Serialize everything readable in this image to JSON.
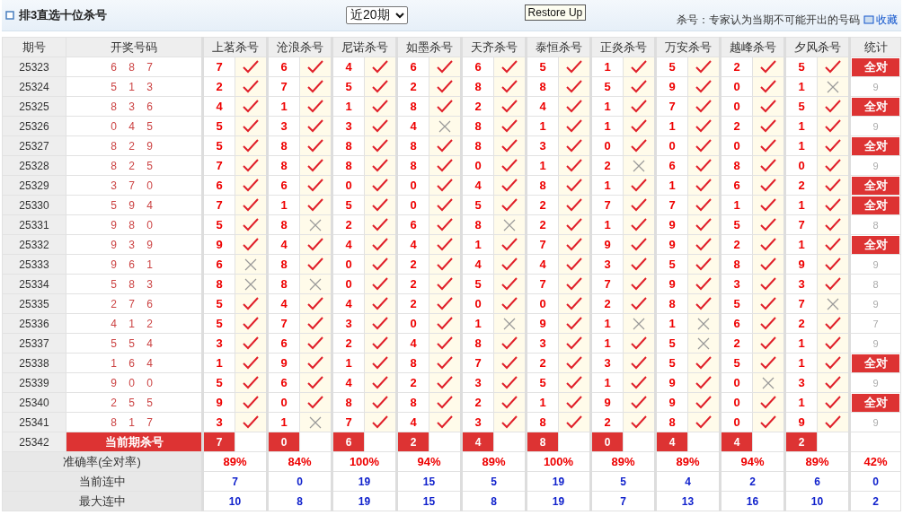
{
  "header": {
    "title": "排3直选十位杀号",
    "period_select": "近20期",
    "tooltip": "Restore Up",
    "note": "杀号：专家认为当期不可能开出的号码",
    "bookmark": "收藏"
  },
  "columns": [
    "期号",
    "开奖号码",
    "上茗杀号",
    "沧浪杀号",
    "尼诺杀号",
    "如墨杀号",
    "天齐杀号",
    "泰恒杀号",
    "正炎杀号",
    "万安杀号",
    "越峰杀号",
    "夕风杀号",
    "统计"
  ],
  "rows": [
    {
      "period": "25323",
      "draw": "6 8 7",
      "picks": [
        {
          "number": "7",
          "hit": true
        },
        {
          "number": "6",
          "hit": true
        },
        {
          "number": "4",
          "hit": true
        },
        {
          "number": "6",
          "hit": true
        },
        {
          "number": "6",
          "hit": true
        },
        {
          "number": "5",
          "hit": true
        },
        {
          "number": "1",
          "hit": true
        },
        {
          "number": "5",
          "hit": true
        },
        {
          "number": "2",
          "hit": true
        },
        {
          "number": "5",
          "hit": true
        }
      ],
      "stat": {
        "text": "全对",
        "all_correct": true
      }
    },
    {
      "period": "25324",
      "draw": "5 1 3",
      "picks": [
        {
          "number": "2",
          "hit": true
        },
        {
          "number": "7",
          "hit": true
        },
        {
          "number": "5",
          "hit": true
        },
        {
          "number": "2",
          "hit": true
        },
        {
          "number": "8",
          "hit": true
        },
        {
          "number": "8",
          "hit": true
        },
        {
          "number": "5",
          "hit": true
        },
        {
          "number": "9",
          "hit": true
        },
        {
          "number": "0",
          "hit": true
        },
        {
          "number": "1",
          "hit": false
        }
      ],
      "stat": {
        "text": "9",
        "all_correct": false
      }
    },
    {
      "period": "25325",
      "draw": "8 3 6",
      "picks": [
        {
          "number": "4",
          "hit": true
        },
        {
          "number": "1",
          "hit": true
        },
        {
          "number": "1",
          "hit": true
        },
        {
          "number": "8",
          "hit": true
        },
        {
          "number": "2",
          "hit": true
        },
        {
          "number": "4",
          "hit": true
        },
        {
          "number": "1",
          "hit": true
        },
        {
          "number": "7",
          "hit": true
        },
        {
          "number": "0",
          "hit": true
        },
        {
          "number": "5",
          "hit": true
        }
      ],
      "stat": {
        "text": "全对",
        "all_correct": true
      }
    },
    {
      "period": "25326",
      "draw": "0 4 5",
      "picks": [
        {
          "number": "5",
          "hit": true
        },
        {
          "number": "3",
          "hit": true
        },
        {
          "number": "3",
          "hit": true
        },
        {
          "number": "4",
          "hit": false
        },
        {
          "number": "8",
          "hit": true
        },
        {
          "number": "1",
          "hit": true
        },
        {
          "number": "1",
          "hit": true
        },
        {
          "number": "1",
          "hit": true
        },
        {
          "number": "2",
          "hit": true
        },
        {
          "number": "1",
          "hit": true
        }
      ],
      "stat": {
        "text": "9",
        "all_correct": false
      }
    },
    {
      "period": "25327",
      "draw": "8 2 9",
      "picks": [
        {
          "number": "5",
          "hit": true
        },
        {
          "number": "8",
          "hit": true
        },
        {
          "number": "8",
          "hit": true
        },
        {
          "number": "8",
          "hit": true
        },
        {
          "number": "8",
          "hit": true
        },
        {
          "number": "3",
          "hit": true
        },
        {
          "number": "0",
          "hit": true
        },
        {
          "number": "0",
          "hit": true
        },
        {
          "number": "0",
          "hit": true
        },
        {
          "number": "1",
          "hit": true
        }
      ],
      "stat": {
        "text": "全对",
        "all_correct": true
      }
    },
    {
      "period": "25328",
      "draw": "8 2 5",
      "picks": [
        {
          "number": "7",
          "hit": true
        },
        {
          "number": "8",
          "hit": true
        },
        {
          "number": "8",
          "hit": true
        },
        {
          "number": "8",
          "hit": true
        },
        {
          "number": "0",
          "hit": true
        },
        {
          "number": "1",
          "hit": true
        },
        {
          "number": "2",
          "hit": false
        },
        {
          "number": "6",
          "hit": true
        },
        {
          "number": "8",
          "hit": true
        },
        {
          "number": "0",
          "hit": true
        }
      ],
      "stat": {
        "text": "9",
        "all_correct": false
      }
    },
    {
      "period": "25329",
      "draw": "3 7 0",
      "picks": [
        {
          "number": "6",
          "hit": true
        },
        {
          "number": "6",
          "hit": true
        },
        {
          "number": "0",
          "hit": true
        },
        {
          "number": "0",
          "hit": true
        },
        {
          "number": "4",
          "hit": true
        },
        {
          "number": "8",
          "hit": true
        },
        {
          "number": "1",
          "hit": true
        },
        {
          "number": "1",
          "hit": true
        },
        {
          "number": "6",
          "hit": true
        },
        {
          "number": "2",
          "hit": true
        }
      ],
      "stat": {
        "text": "全对",
        "all_correct": true
      }
    },
    {
      "period": "25330",
      "draw": "5 9 4",
      "picks": [
        {
          "number": "7",
          "hit": true
        },
        {
          "number": "1",
          "hit": true
        },
        {
          "number": "5",
          "hit": true
        },
        {
          "number": "0",
          "hit": true
        },
        {
          "number": "5",
          "hit": true
        },
        {
          "number": "2",
          "hit": true
        },
        {
          "number": "7",
          "hit": true
        },
        {
          "number": "7",
          "hit": true
        },
        {
          "number": "1",
          "hit": true
        },
        {
          "number": "1",
          "hit": true
        }
      ],
      "stat": {
        "text": "全对",
        "all_correct": true
      }
    },
    {
      "period": "25331",
      "draw": "9 8 0",
      "picks": [
        {
          "number": "5",
          "hit": true
        },
        {
          "number": "8",
          "hit": false
        },
        {
          "number": "2",
          "hit": true
        },
        {
          "number": "6",
          "hit": true
        },
        {
          "number": "8",
          "hit": false
        },
        {
          "number": "2",
          "hit": true
        },
        {
          "number": "1",
          "hit": true
        },
        {
          "number": "9",
          "hit": true
        },
        {
          "number": "5",
          "hit": true
        },
        {
          "number": "7",
          "hit": true
        }
      ],
      "stat": {
        "text": "8",
        "all_correct": false
      }
    },
    {
      "period": "25332",
      "draw": "9 3 9",
      "picks": [
        {
          "number": "9",
          "hit": true
        },
        {
          "number": "4",
          "hit": true
        },
        {
          "number": "4",
          "hit": true
        },
        {
          "number": "4",
          "hit": true
        },
        {
          "number": "1",
          "hit": true
        },
        {
          "number": "7",
          "hit": true
        },
        {
          "number": "9",
          "hit": true
        },
        {
          "number": "9",
          "hit": true
        },
        {
          "number": "2",
          "hit": true
        },
        {
          "number": "1",
          "hit": true
        }
      ],
      "stat": {
        "text": "全对",
        "all_correct": true
      }
    },
    {
      "period": "25333",
      "draw": "9 6 1",
      "picks": [
        {
          "number": "6",
          "hit": false
        },
        {
          "number": "8",
          "hit": true
        },
        {
          "number": "0",
          "hit": true
        },
        {
          "number": "2",
          "hit": true
        },
        {
          "number": "4",
          "hit": true
        },
        {
          "number": "4",
          "hit": true
        },
        {
          "number": "3",
          "hit": true
        },
        {
          "number": "5",
          "hit": true
        },
        {
          "number": "8",
          "hit": true
        },
        {
          "number": "9",
          "hit": true
        }
      ],
      "stat": {
        "text": "9",
        "all_correct": false
      }
    },
    {
      "period": "25334",
      "draw": "5 8 3",
      "picks": [
        {
          "number": "8",
          "hit": false
        },
        {
          "number": "8",
          "hit": false
        },
        {
          "number": "0",
          "hit": true
        },
        {
          "number": "2",
          "hit": true
        },
        {
          "number": "5",
          "hit": true
        },
        {
          "number": "7",
          "hit": true
        },
        {
          "number": "7",
          "hit": true
        },
        {
          "number": "9",
          "hit": true
        },
        {
          "number": "3",
          "hit": true
        },
        {
          "number": "3",
          "hit": true
        }
      ],
      "stat": {
        "text": "8",
        "all_correct": false
      }
    },
    {
      "period": "25335",
      "draw": "2 7 6",
      "picks": [
        {
          "number": "5",
          "hit": true
        },
        {
          "number": "4",
          "hit": true
        },
        {
          "number": "4",
          "hit": true
        },
        {
          "number": "2",
          "hit": true
        },
        {
          "number": "0",
          "hit": true
        },
        {
          "number": "0",
          "hit": true
        },
        {
          "number": "2",
          "hit": true
        },
        {
          "number": "8",
          "hit": true
        },
        {
          "number": "5",
          "hit": true
        },
        {
          "number": "7",
          "hit": false
        }
      ],
      "stat": {
        "text": "9",
        "all_correct": false
      }
    },
    {
      "period": "25336",
      "draw": "4 1 2",
      "picks": [
        {
          "number": "5",
          "hit": true
        },
        {
          "number": "7",
          "hit": true
        },
        {
          "number": "3",
          "hit": true
        },
        {
          "number": "0",
          "hit": true
        },
        {
          "number": "1",
          "hit": false
        },
        {
          "number": "9",
          "hit": true
        },
        {
          "number": "1",
          "hit": false
        },
        {
          "number": "1",
          "hit": false
        },
        {
          "number": "6",
          "hit": true
        },
        {
          "number": "2",
          "hit": true
        }
      ],
      "stat": {
        "text": "7",
        "all_correct": false
      }
    },
    {
      "period": "25337",
      "draw": "5 5 4",
      "picks": [
        {
          "number": "3",
          "hit": true
        },
        {
          "number": "6",
          "hit": true
        },
        {
          "number": "2",
          "hit": true
        },
        {
          "number": "4",
          "hit": true
        },
        {
          "number": "8",
          "hit": true
        },
        {
          "number": "3",
          "hit": true
        },
        {
          "number": "1",
          "hit": true
        },
        {
          "number": "5",
          "hit": false
        },
        {
          "number": "2",
          "hit": true
        },
        {
          "number": "1",
          "hit": true
        }
      ],
      "stat": {
        "text": "9",
        "all_correct": false
      }
    },
    {
      "period": "25338",
      "draw": "1 6 4",
      "picks": [
        {
          "number": "1",
          "hit": true
        },
        {
          "number": "9",
          "hit": true
        },
        {
          "number": "1",
          "hit": true
        },
        {
          "number": "8",
          "hit": true
        },
        {
          "number": "7",
          "hit": true
        },
        {
          "number": "2",
          "hit": true
        },
        {
          "number": "3",
          "hit": true
        },
        {
          "number": "5",
          "hit": true
        },
        {
          "number": "5",
          "hit": true
        },
        {
          "number": "1",
          "hit": true
        }
      ],
      "stat": {
        "text": "全对",
        "all_correct": true
      }
    },
    {
      "period": "25339",
      "draw": "9 0 0",
      "picks": [
        {
          "number": "5",
          "hit": true
        },
        {
          "number": "6",
          "hit": true
        },
        {
          "number": "4",
          "hit": true
        },
        {
          "number": "2",
          "hit": true
        },
        {
          "number": "3",
          "hit": true
        },
        {
          "number": "5",
          "hit": true
        },
        {
          "number": "1",
          "hit": true
        },
        {
          "number": "9",
          "hit": true
        },
        {
          "number": "0",
          "hit": false
        },
        {
          "number": "3",
          "hit": true
        }
      ],
      "stat": {
        "text": "9",
        "all_correct": false
      }
    },
    {
      "period": "25340",
      "draw": "2 5 5",
      "picks": [
        {
          "number": "9",
          "hit": true
        },
        {
          "number": "0",
          "hit": true
        },
        {
          "number": "8",
          "hit": true
        },
        {
          "number": "8",
          "hit": true
        },
        {
          "number": "2",
          "hit": true
        },
        {
          "number": "1",
          "hit": true
        },
        {
          "number": "9",
          "hit": true
        },
        {
          "number": "9",
          "hit": true
        },
        {
          "number": "0",
          "hit": true
        },
        {
          "number": "1",
          "hit": true
        }
      ],
      "stat": {
        "text": "全对",
        "all_correct": true
      }
    },
    {
      "period": "25341",
      "draw": "8 1 7",
      "picks": [
        {
          "number": "3",
          "hit": true
        },
        {
          "number": "1",
          "hit": false
        },
        {
          "number": "7",
          "hit": true
        },
        {
          "number": "4",
          "hit": true
        },
        {
          "number": "3",
          "hit": true
        },
        {
          "number": "8",
          "hit": true
        },
        {
          "number": "2",
          "hit": true
        },
        {
          "number": "8",
          "hit": true
        },
        {
          "number": "0",
          "hit": true
        },
        {
          "number": "9",
          "hit": true
        }
      ],
      "stat": {
        "text": "9",
        "all_correct": false
      }
    }
  ],
  "current": {
    "period": "25342",
    "label": "当前期杀号",
    "picks": [
      "7",
      "0",
      "6",
      "2",
      "4",
      "8",
      "0",
      "4",
      "4",
      "2"
    ]
  },
  "summary": [
    {
      "label": "准确率(全对率)",
      "kind": "rate",
      "values": [
        "89%",
        "84%",
        "100%",
        "94%",
        "89%",
        "100%",
        "89%",
        "89%",
        "94%",
        "89%",
        "42%"
      ]
    },
    {
      "label": "当前连中",
      "kind": "streak",
      "values": [
        "7",
        "0",
        "19",
        "15",
        "5",
        "19",
        "5",
        "4",
        "2",
        "6",
        "0"
      ]
    },
    {
      "label": "最大连中",
      "kind": "streak",
      "values": [
        "10",
        "8",
        "19",
        "15",
        "8",
        "19",
        "7",
        "13",
        "16",
        "10",
        "2"
      ]
    }
  ]
}
